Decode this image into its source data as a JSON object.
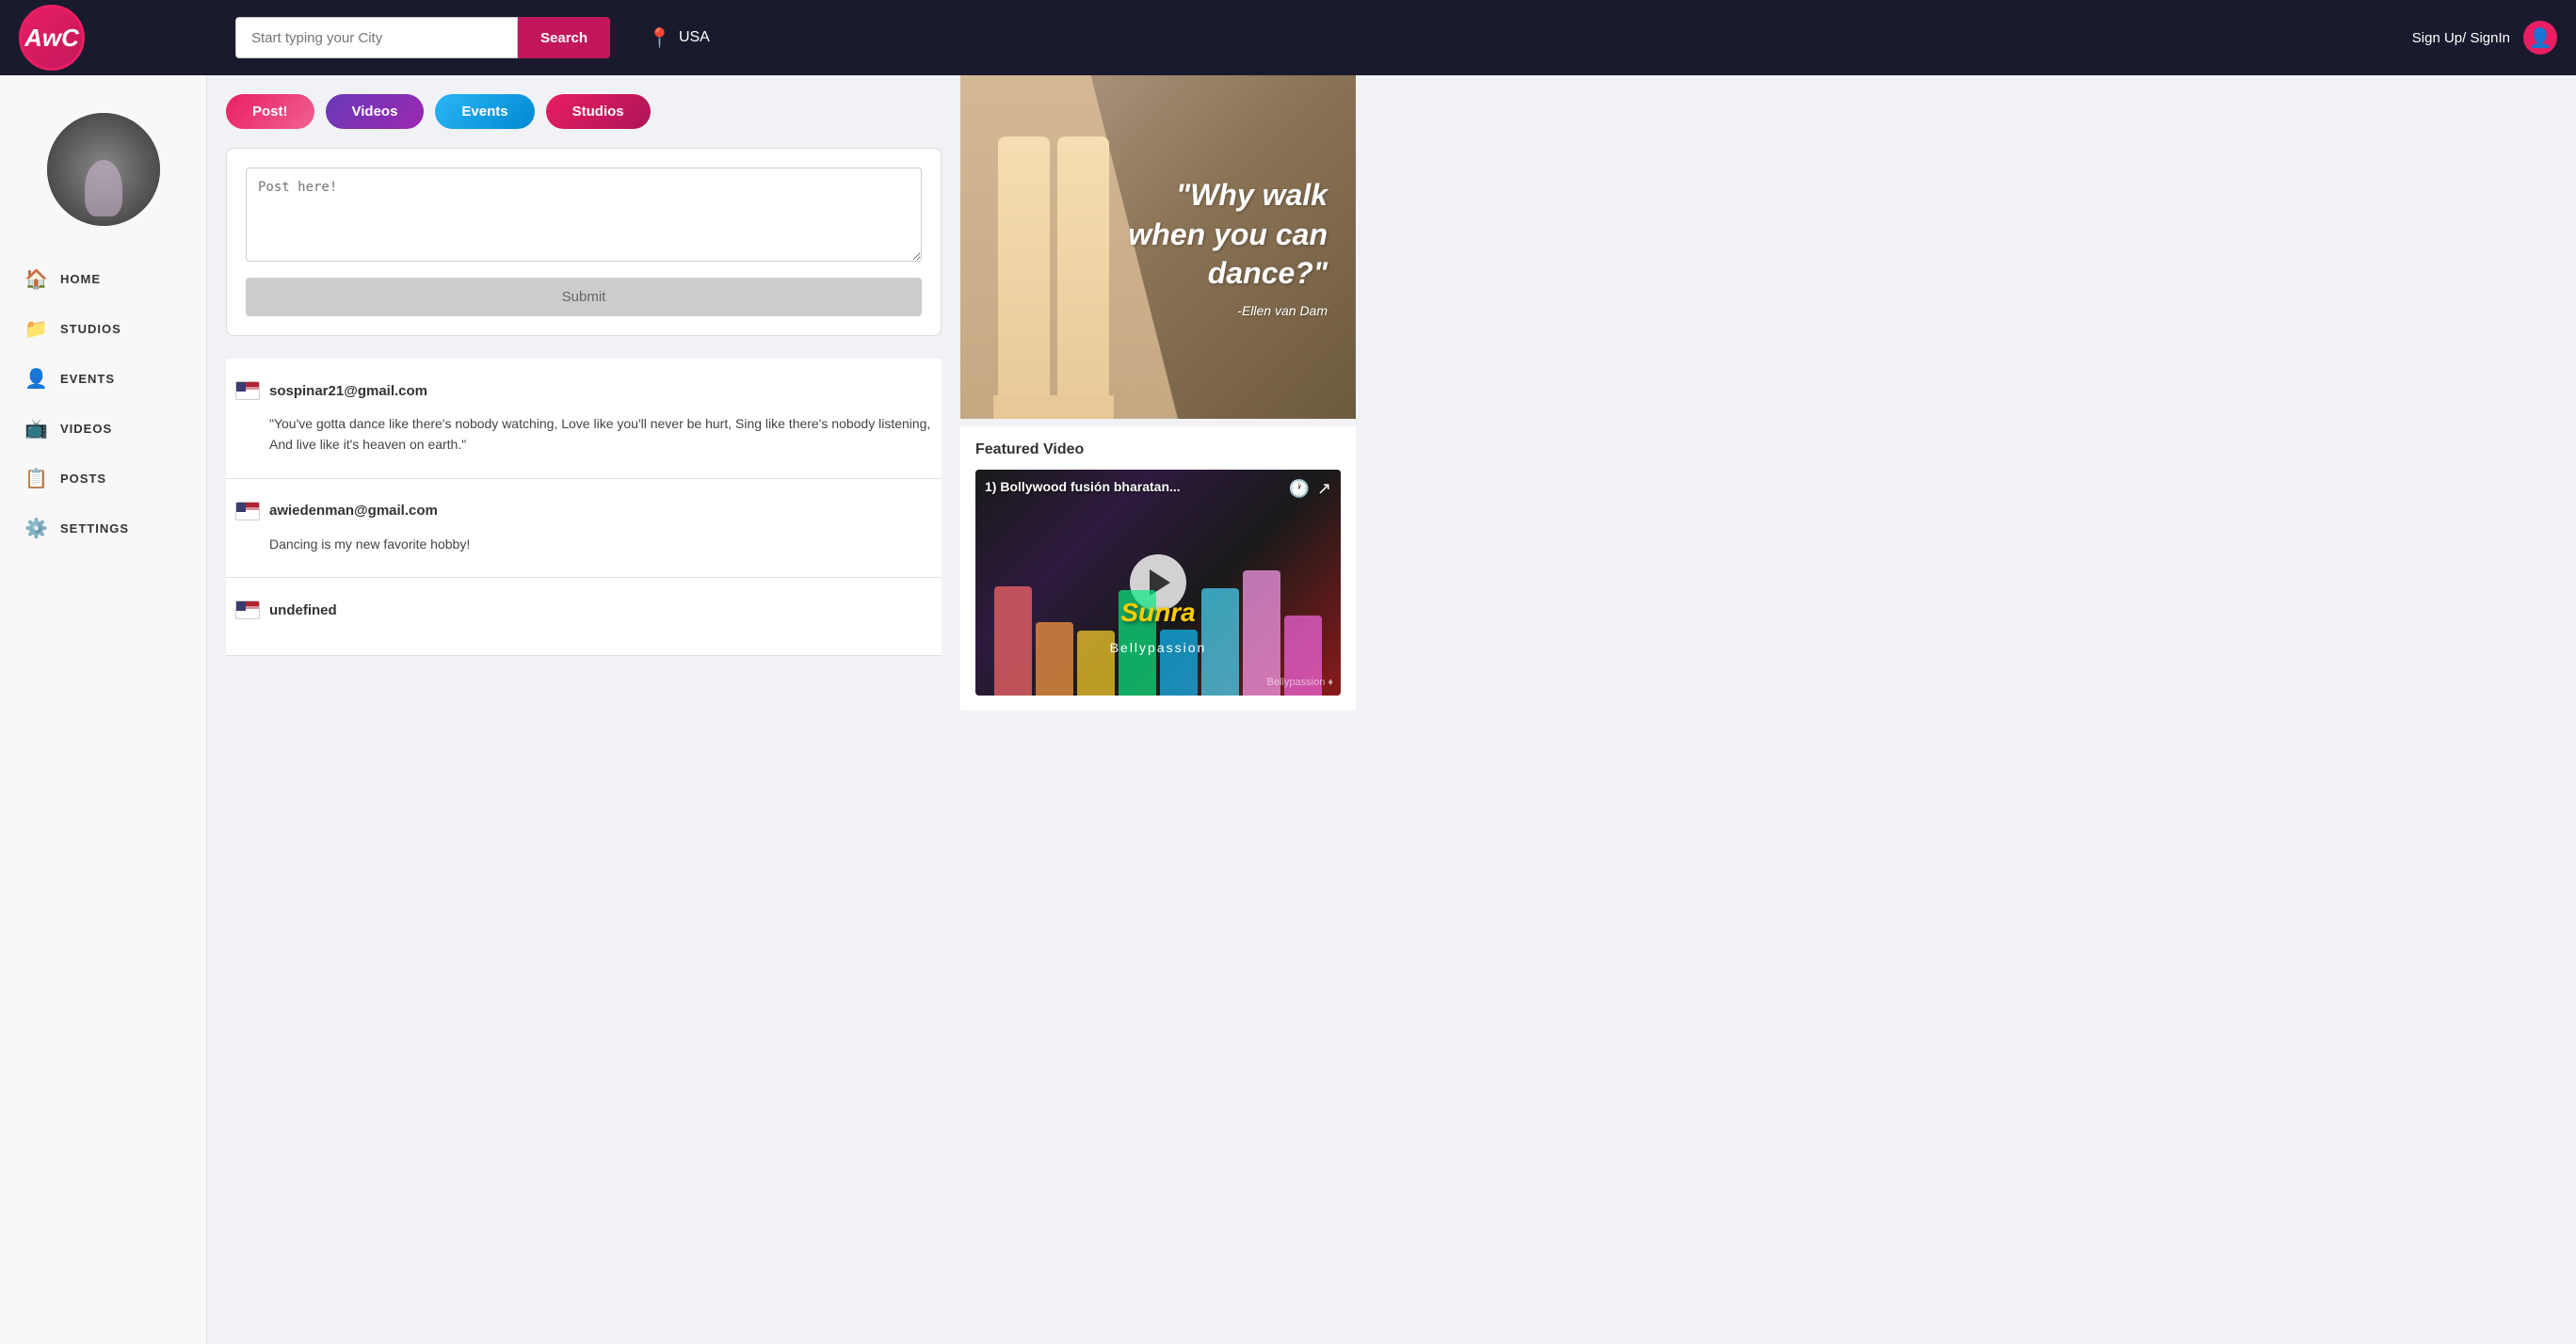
{
  "header": {
    "logo_text": "AwC",
    "search_placeholder": "Start typing your City",
    "search_btn_label": "Search",
    "location_text": "USA",
    "signin_label": "Sign Up/ SignIn"
  },
  "sidebar": {
    "nav_items": [
      {
        "id": "home",
        "label": "HOME",
        "icon": "🏠"
      },
      {
        "id": "studios",
        "label": "STUDIOS",
        "icon": "📁"
      },
      {
        "id": "events",
        "label": "EVENTS",
        "icon": "👤"
      },
      {
        "id": "videos",
        "label": "VIDEOS",
        "icon": "📺"
      },
      {
        "id": "posts",
        "label": "POSTS",
        "icon": "📋"
      },
      {
        "id": "settings",
        "label": "SETTINGS",
        "icon": "⚙️"
      }
    ]
  },
  "tabs": [
    {
      "id": "post",
      "label": "Post!",
      "style": "post"
    },
    {
      "id": "videos",
      "label": "Videos",
      "style": "videos"
    },
    {
      "id": "events",
      "label": "Events",
      "style": "events"
    },
    {
      "id": "studios",
      "label": "Studios",
      "style": "studios"
    }
  ],
  "post_box": {
    "placeholder": "Post here!",
    "submit_label": "Submit"
  },
  "posts": [
    {
      "id": "post1",
      "author": "sospinar21@gmail.com",
      "text": "\"You've gotta dance like there's nobody watching, Love like you'll never be hurt, Sing like there's nobody listening, And live like it's heaven on earth.\""
    },
    {
      "id": "post2",
      "author": "awiedenman@gmail.com",
      "text": "Dancing is my new favorite hobby!"
    },
    {
      "id": "post3",
      "author": "undefined",
      "text": ""
    }
  ],
  "quote_banner": {
    "quote": "\"Why walk when you can dance?\"",
    "author": "-Ellen van Dam"
  },
  "featured_video": {
    "title": "Featured Video",
    "video_title": "1) Bollywood fusión bharatan...",
    "sunra_text": "Sunra",
    "bellypassion_text": "Bellypassion",
    "watermark": "Bellypassion ♦"
  },
  "colors": {
    "accent": "#c2185b",
    "primary": "#1a1a2e",
    "tab_post": "#e91e63",
    "tab_videos": "#9c27b0",
    "tab_events": "#29b6f6",
    "tab_studios": "#ad1457"
  },
  "bar_colors": [
    "#ff6b6b",
    "#ff9f43",
    "#ffd32a",
    "#0be881",
    "#0fbcf9",
    "#48dbfb",
    "#ff9ff3",
    "#f368e0"
  ]
}
